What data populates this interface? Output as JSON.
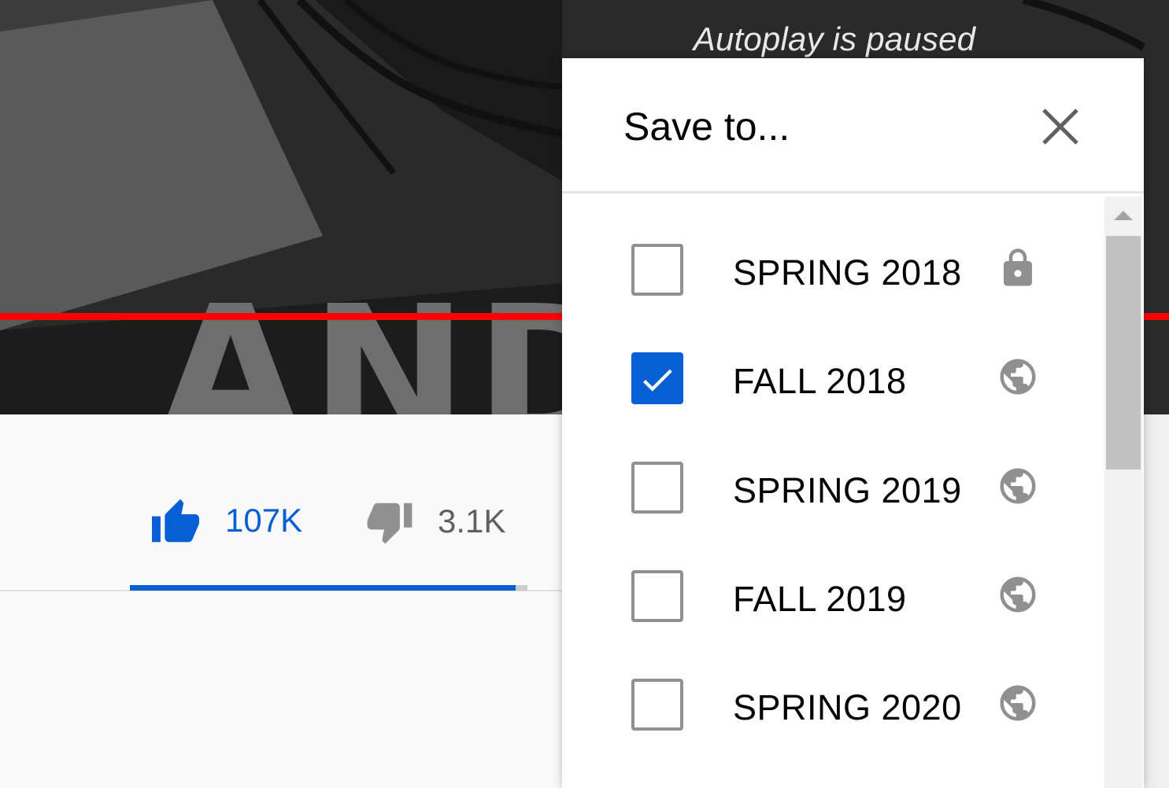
{
  "video": {
    "autoplay_notice": "Autoplay is paused",
    "progress_color": "#ff0000"
  },
  "actions": {
    "like_count": "107K",
    "dislike_count": "3.1K",
    "like_ratio": 0.97,
    "accent_color": "#065fd4"
  },
  "dialog": {
    "title": "Save to...",
    "close_icon": "close-icon",
    "playlists": [
      {
        "label": "SPRING 2018",
        "checked": false,
        "privacy": "lock-icon"
      },
      {
        "label": "FALL 2018",
        "checked": true,
        "privacy": "globe-icon"
      },
      {
        "label": "SPRING 2019",
        "checked": false,
        "privacy": "globe-icon"
      },
      {
        "label": "FALL 2019",
        "checked": false,
        "privacy": "globe-icon"
      },
      {
        "label": "SPRING 2020",
        "checked": false,
        "privacy": "globe-icon"
      }
    ]
  }
}
